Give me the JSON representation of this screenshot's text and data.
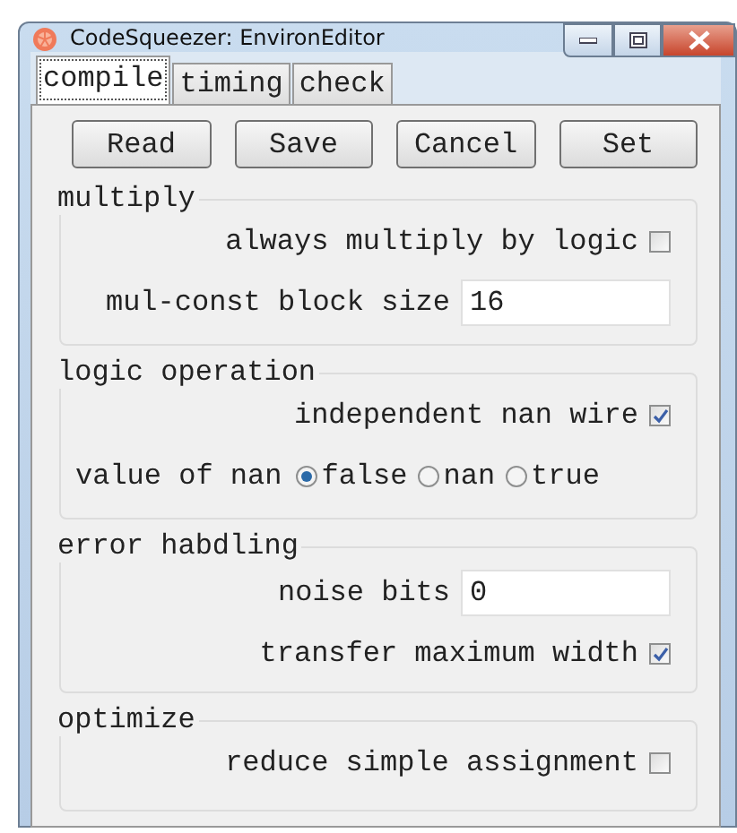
{
  "window": {
    "title": "CodeSqueezer: EnvironEditor"
  },
  "tabs": [
    {
      "label": "compile",
      "selected": true
    },
    {
      "label": "timing",
      "selected": false
    },
    {
      "label": "check",
      "selected": false
    }
  ],
  "buttons": [
    "Read",
    "Save",
    "Cancel",
    "Set"
  ],
  "groups": [
    {
      "title": "multiply",
      "rows": [
        {
          "kind": "checkbox",
          "label": "always multiply by logic",
          "checked": false
        },
        {
          "kind": "field",
          "label": "mul-const block size",
          "value": "16"
        }
      ]
    },
    {
      "title": "logic operation",
      "rows": [
        {
          "kind": "checkbox",
          "label": "independent nan wire",
          "checked": true
        },
        {
          "kind": "radio",
          "label": "value of nan",
          "options": [
            {
              "label": "false",
              "selected": true
            },
            {
              "label": "nan",
              "selected": false
            },
            {
              "label": "true",
              "selected": false
            }
          ]
        }
      ]
    },
    {
      "title": "error habdling",
      "rows": [
        {
          "kind": "field",
          "label": "noise bits",
          "value": "0"
        },
        {
          "kind": "checkbox",
          "label": "transfer maximum width",
          "checked": true
        }
      ]
    },
    {
      "title": "optimize",
      "rows": [
        {
          "kind": "checkbox",
          "label": "reduce simple assignment",
          "checked": false
        }
      ]
    }
  ]
}
